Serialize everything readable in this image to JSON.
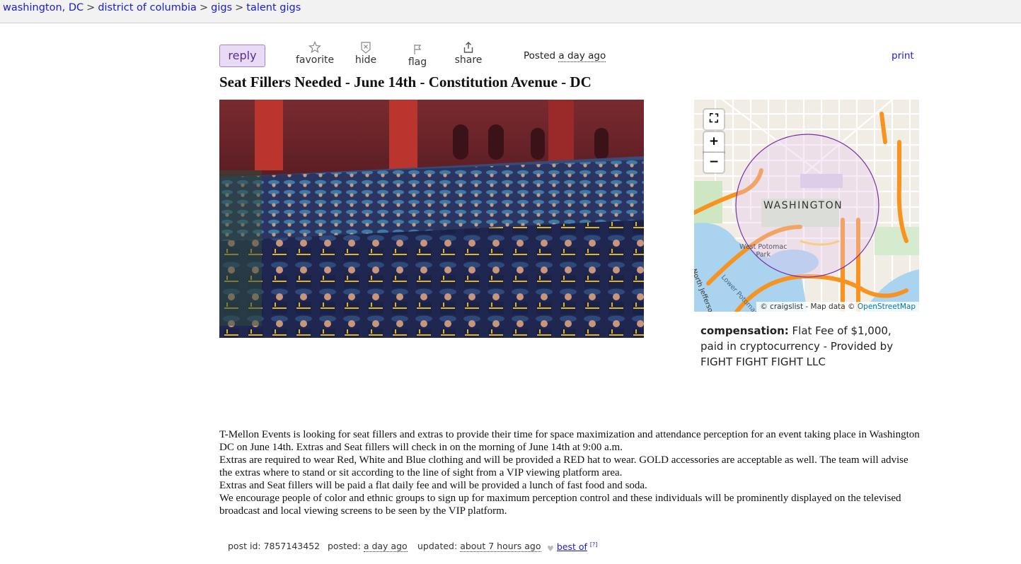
{
  "breadcrumb": {
    "items": [
      "washington, DC",
      "district of columbia",
      "gigs",
      "talent gigs"
    ],
    "separator": ">"
  },
  "actions": {
    "reply": "reply",
    "favorite": "favorite",
    "hide": "hide",
    "flag": "flag",
    "share": "share",
    "posted_prefix": "Posted",
    "posted_ago": "a day ago",
    "print": "print"
  },
  "post": {
    "title": "Seat Fillers Needed - June 14th - Constitution Avenue - DC",
    "body": [
      "T-Mellon Events is looking for seat fillers and extras to provide their time for space maximization and attendance perception for an event taking place in Washington DC on June 14th. Extras and Seat fillers will check in on the morning of June 14th at 9:00 a.m.",
      "Extras are required to wear Red, White and Blue clothing and will be provided a RED hat to wear. GOLD accessories are acceptable as well. The team will advise the extras where to stand or sit according to the line of sight from a VIP viewing platform area.",
      "Extras and Seat fillers will be paid a flat daily fee and will be provided a lunch of fast food and soda.",
      "We encourage people of color and ethnic groups to sign up for maximum perception control and these individuals will be prominently displayed on the televised broadcast and local viewing screens to be seen by the VIP platform."
    ]
  },
  "map": {
    "label": "WASHINGTON",
    "park_label_1": "West Potomac",
    "park_label_2": "Park",
    "river_label": "Lower Potomac Riv",
    "street_label": "North Jefferson Dr",
    "fullscreen": "⛶",
    "zoom_in": "+",
    "zoom_out": "−",
    "attribution_prefix": "© craigslist - Map data ©",
    "attribution_link": "OpenStreetMap"
  },
  "compensation": {
    "label": "compensation:",
    "value": "Flat Fee of $1,000, paid in cryptocurrency - Provided by FIGHT FIGHT FIGHT LLC"
  },
  "postinfo": {
    "post_id_label": "post id:",
    "post_id": "7857143452",
    "posted_label": "posted:",
    "posted_value": "a day ago",
    "updated_label": "updated:",
    "updated_value": "about 7 hours ago",
    "best_of": "best of",
    "help_mark": "[?]"
  },
  "colors": {
    "link": "#1a1adc",
    "reply_bg": "#e9dbf5",
    "reply_border": "#a97fcf",
    "map_circle": "#7a2fa8",
    "map_highway": "#f7931e",
    "map_water": "#a9d3ee"
  },
  "icons": {
    "favorite": "star-icon",
    "hide": "hide-icon",
    "flag": "flag-icon",
    "share": "share-icon",
    "bestof": "heart-icon"
  }
}
